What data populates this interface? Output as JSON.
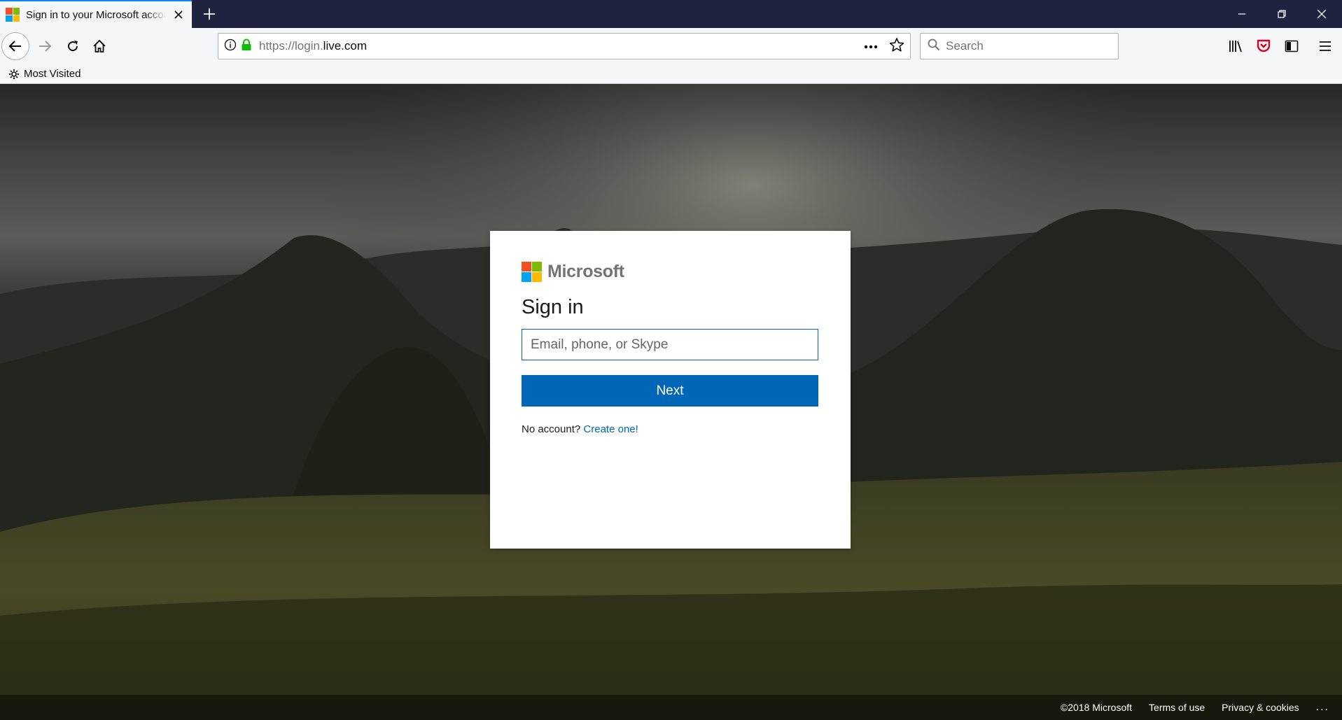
{
  "browser": {
    "tab": {
      "title": "Sign in to your Microsoft account"
    },
    "url": {
      "scheme": "https://login.",
      "domain": "live.com"
    },
    "search": {
      "placeholder": "Search"
    },
    "bookmarks": {
      "most_visited": "Most Visited"
    },
    "colors": {
      "tabbar": "#202340",
      "accent": "#0a84ff",
      "pocket": "#d70022"
    }
  },
  "signin": {
    "brand": "Microsoft",
    "title": "Sign in",
    "email_placeholder": "Email, phone, or Skype",
    "next_label": "Next",
    "no_account_text": "No account?",
    "create_link": "Create one!",
    "colors": {
      "primary": "#0067b8",
      "logo": [
        "#f25022",
        "#7fba00",
        "#00a4ef",
        "#ffb900"
      ]
    }
  },
  "footer": {
    "copyright": "©2018 Microsoft",
    "terms": "Terms of use",
    "privacy": "Privacy & cookies",
    "more": "..."
  },
  "icons": {
    "close": "close-icon",
    "plus": "plus-icon",
    "back": "back-arrow-icon",
    "forward": "forward-arrow-icon",
    "reload": "reload-icon",
    "home": "home-icon",
    "info": "info-icon",
    "lock": "lock-icon",
    "more": "more-dots-icon",
    "star": "bookmark-star-icon",
    "search": "search-icon",
    "library": "library-icon",
    "pocket": "pocket-icon",
    "sidebar": "sidebar-icon",
    "menu": "hamburger-menu-icon",
    "gear": "gear-icon",
    "minimize": "minimize-icon",
    "restore": "restore-icon"
  }
}
